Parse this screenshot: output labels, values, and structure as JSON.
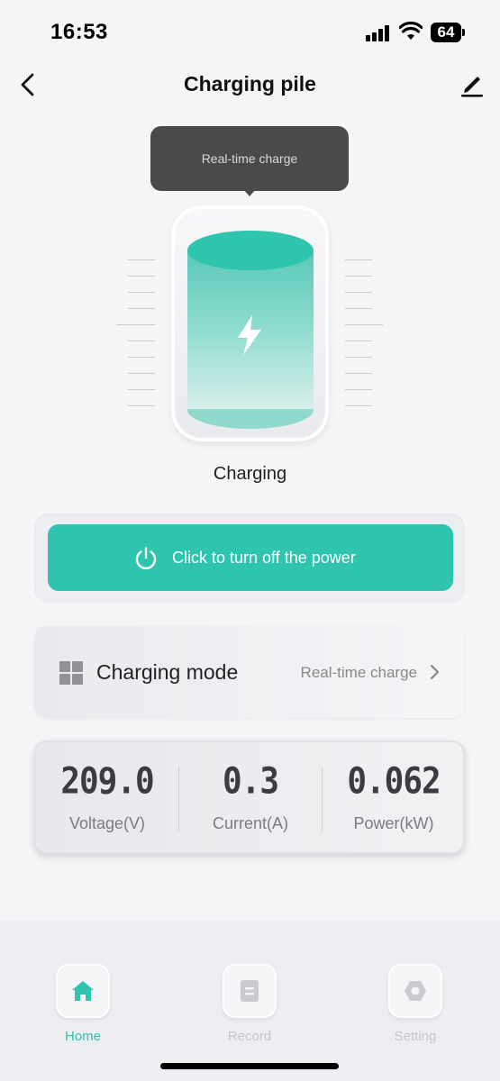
{
  "status_bar": {
    "time": "16:53",
    "battery": "64"
  },
  "nav": {
    "title": "Charging pile",
    "back_icon": "chevron-left-icon",
    "edit_icon": "pencil-icon"
  },
  "tooltip": {
    "text": "Real-time charge"
  },
  "charger": {
    "status": "Charging",
    "icon": "lightning-bolt-icon"
  },
  "power_button": {
    "label": "Click to turn off the power",
    "icon": "power-icon"
  },
  "charging_mode": {
    "label": "Charging mode",
    "value": "Real-time charge",
    "icon": "grid-icon"
  },
  "metrics": [
    {
      "value": "209.0",
      "label": "Voltage(V)"
    },
    {
      "value": "0.3",
      "label": "Current(A)"
    },
    {
      "value": "0.062",
      "label": "Power(kW)"
    }
  ],
  "tabs": [
    {
      "label": "Home",
      "icon": "home-icon",
      "active": true
    },
    {
      "label": "Record",
      "icon": "record-icon",
      "active": false
    },
    {
      "label": "Setting",
      "icon": "settings-icon",
      "active": false
    }
  ],
  "colors": {
    "accent": "#2ec4ad",
    "tooltip": "#4a4a4a",
    "background": "#f4f5f7"
  }
}
